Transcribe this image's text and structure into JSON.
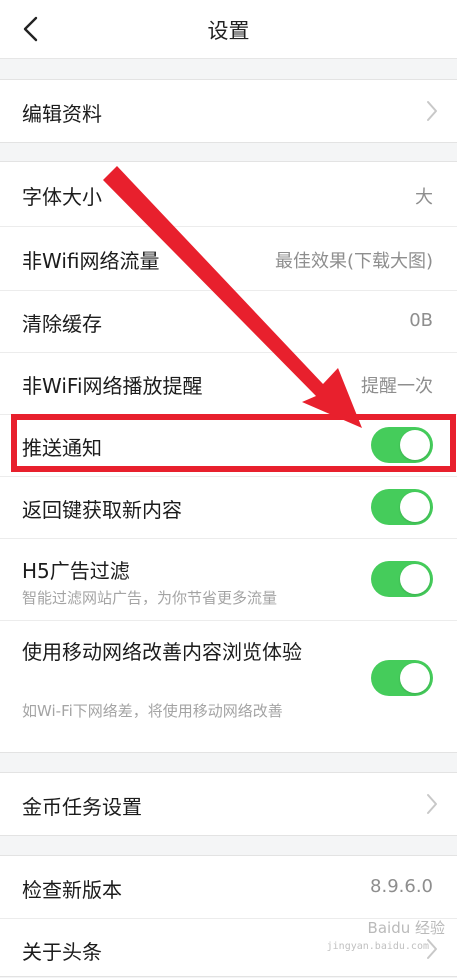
{
  "header": {
    "title": "设置",
    "back_icon": "chevron-left-icon"
  },
  "group1": {
    "edit_profile": "编辑资料"
  },
  "group2": {
    "font_size": {
      "label": "字体大小",
      "value": "大"
    },
    "non_wifi_traffic": {
      "label": "非Wifi网络流量",
      "value": "最佳效果(下载大图)"
    },
    "clear_cache": {
      "label": "清除缓存",
      "value": "0B"
    },
    "non_wifi_play_reminder": {
      "label": "非WiFi网络播放提醒",
      "value": "提醒一次"
    },
    "push_notify": {
      "label": "推送通知",
      "on": true
    },
    "back_key_refresh": {
      "label": "返回键获取新内容",
      "on": true
    },
    "h5_ad_filter": {
      "label": "H5广告过滤",
      "sub": "智能过滤网站广告，为你节省更多流量",
      "on": true
    },
    "mobile_network_improve": {
      "label": "使用移动网络改善内容浏览体验",
      "sub": "如Wi-Fi下网络差，将使用移动网络改善",
      "on": true
    }
  },
  "group3": {
    "coin_task": "金币任务设置"
  },
  "group4": {
    "check_version": {
      "label": "检查新版本",
      "value": "8.9.6.0"
    },
    "about": {
      "label": "关于头条"
    }
  },
  "annotation": {
    "highlight_color": "#e8202d",
    "toggle_color": "#45cc5b"
  },
  "watermark": {
    "text": "Baidu 经验",
    "sub": "jingyan.baidu.com"
  }
}
